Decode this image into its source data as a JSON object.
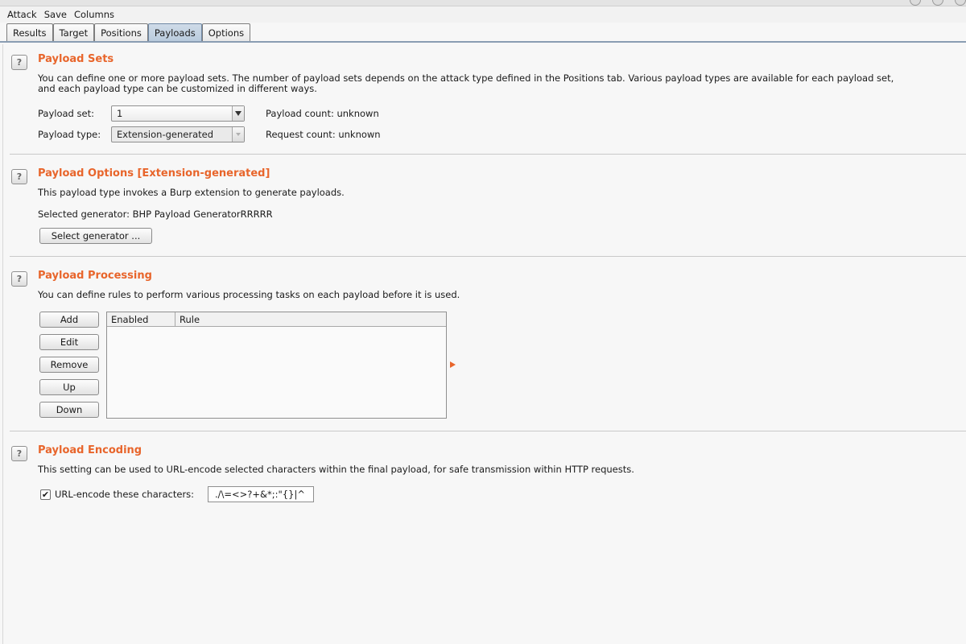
{
  "menubar": [
    "Attack",
    "Save",
    "Columns"
  ],
  "tabs": [
    {
      "label": "Results",
      "active": false
    },
    {
      "label": "Target",
      "active": false
    },
    {
      "label": "Positions",
      "active": false
    },
    {
      "label": "Payloads",
      "active": true
    },
    {
      "label": "Options",
      "active": false
    }
  ],
  "help_glyph": "?",
  "payload_sets": {
    "title": "Payload Sets",
    "description_1": "You can define one or more payload sets. The number of payload sets depends on the attack type defined in the Positions tab. Various payload types are available for each payload set,",
    "description_2": "and each payload type can be customized in different ways.",
    "set_label": "Payload set:",
    "set_value": "1",
    "type_label": "Payload type:",
    "type_value": "Extension-generated",
    "payload_count": "Payload count: unknown",
    "request_count": "Request count: unknown"
  },
  "payload_options": {
    "title": "Payload Options [Extension-generated]",
    "description": "This payload type invokes a Burp extension to generate payloads.",
    "selected_generator": "Selected generator: BHP Payload GeneratorRRRRR",
    "select_button": "Select generator ..."
  },
  "payload_processing": {
    "title": "Payload Processing",
    "description": "You can define rules to perform various processing tasks on each payload before it is used.",
    "buttons": [
      "Add",
      "Edit",
      "Remove",
      "Up",
      "Down"
    ],
    "columns": [
      "Enabled",
      "Rule"
    ],
    "rows": []
  },
  "payload_encoding": {
    "title": "Payload Encoding",
    "description": "This setting can be used to URL-encode selected characters within the final payload, for safe transmission within HTTP requests.",
    "checkbox_label": "URL-encode these characters:",
    "checked": true,
    "check_glyph": "✔",
    "characters": "./\\=<>?+&*;:\"{}|^"
  },
  "colors": {
    "accent": "#e8652b",
    "tab_active": "#c3d3e3"
  }
}
